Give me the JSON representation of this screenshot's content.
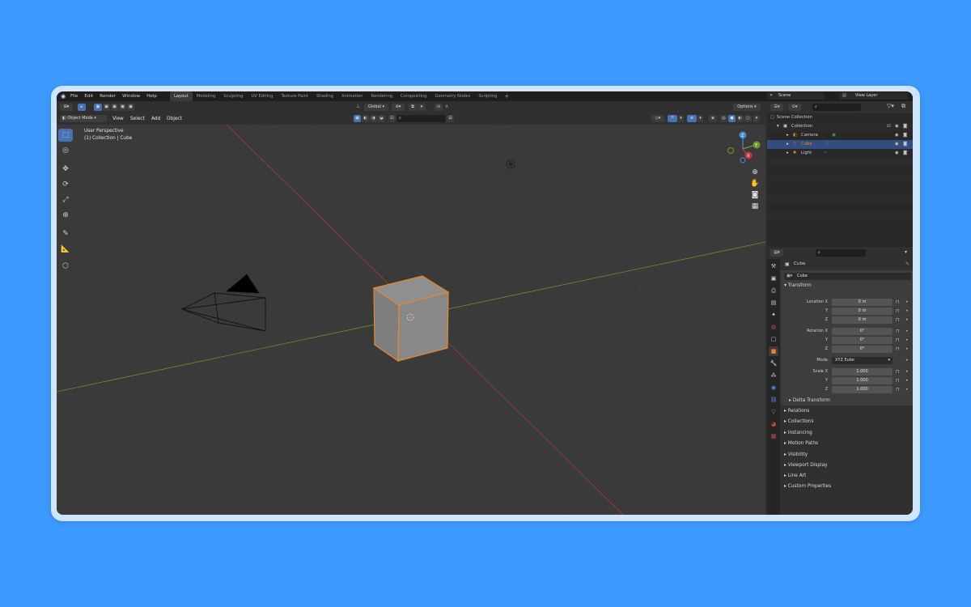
{
  "menu": [
    "File",
    "Edit",
    "Render",
    "Window",
    "Help"
  ],
  "workspaces": [
    "Layout",
    "Modeling",
    "Sculpting",
    "UV Editing",
    "Texture Paint",
    "Shading",
    "Animation",
    "Rendering",
    "Compositing",
    "Geometry Nodes",
    "Scripting"
  ],
  "active_workspace": "Layout",
  "scene": "Scene",
  "view_layer": "View Layer",
  "viewport": {
    "mode": "Object Mode",
    "header_menu": [
      "View",
      "Select",
      "Add",
      "Object"
    ],
    "orientation": "Global",
    "options": "Options",
    "info_line1": "User Perspective",
    "info_line2": "(1) Collection | Cube"
  },
  "outliner": {
    "root": "Scene Collection",
    "collection": "Collection",
    "items": [
      "Camera",
      "Cube",
      "Light"
    ],
    "selected": "Cube"
  },
  "properties": {
    "object_name": "Cube",
    "object_datablock": "Cube",
    "transform_title": "Transform",
    "location_label": "Location X",
    "rotation_label": "Rotation X",
    "scale_label": "Scale X",
    "y_label": "Y",
    "z_label": "Z",
    "location": [
      "0 m",
      "0 m",
      "0 m"
    ],
    "rotation": [
      "0°",
      "0°",
      "0°"
    ],
    "mode_label": "Mode",
    "mode_value": "XYZ Euler",
    "scale": [
      "1.000",
      "1.000",
      "1.000"
    ],
    "delta_transform": "Delta Transform",
    "panels": [
      "Relations",
      "Collections",
      "Instancing",
      "Motion Paths",
      "Visibility",
      "Viewport Display",
      "Line Art",
      "Custom Properties"
    ]
  },
  "colors": {
    "background": "#3d9bff",
    "selection_orange": "#e8872a",
    "accent_blue": "#4772b3",
    "x_axis_red": "#a83a3a",
    "y_axis_green": "#6e8c2a"
  }
}
